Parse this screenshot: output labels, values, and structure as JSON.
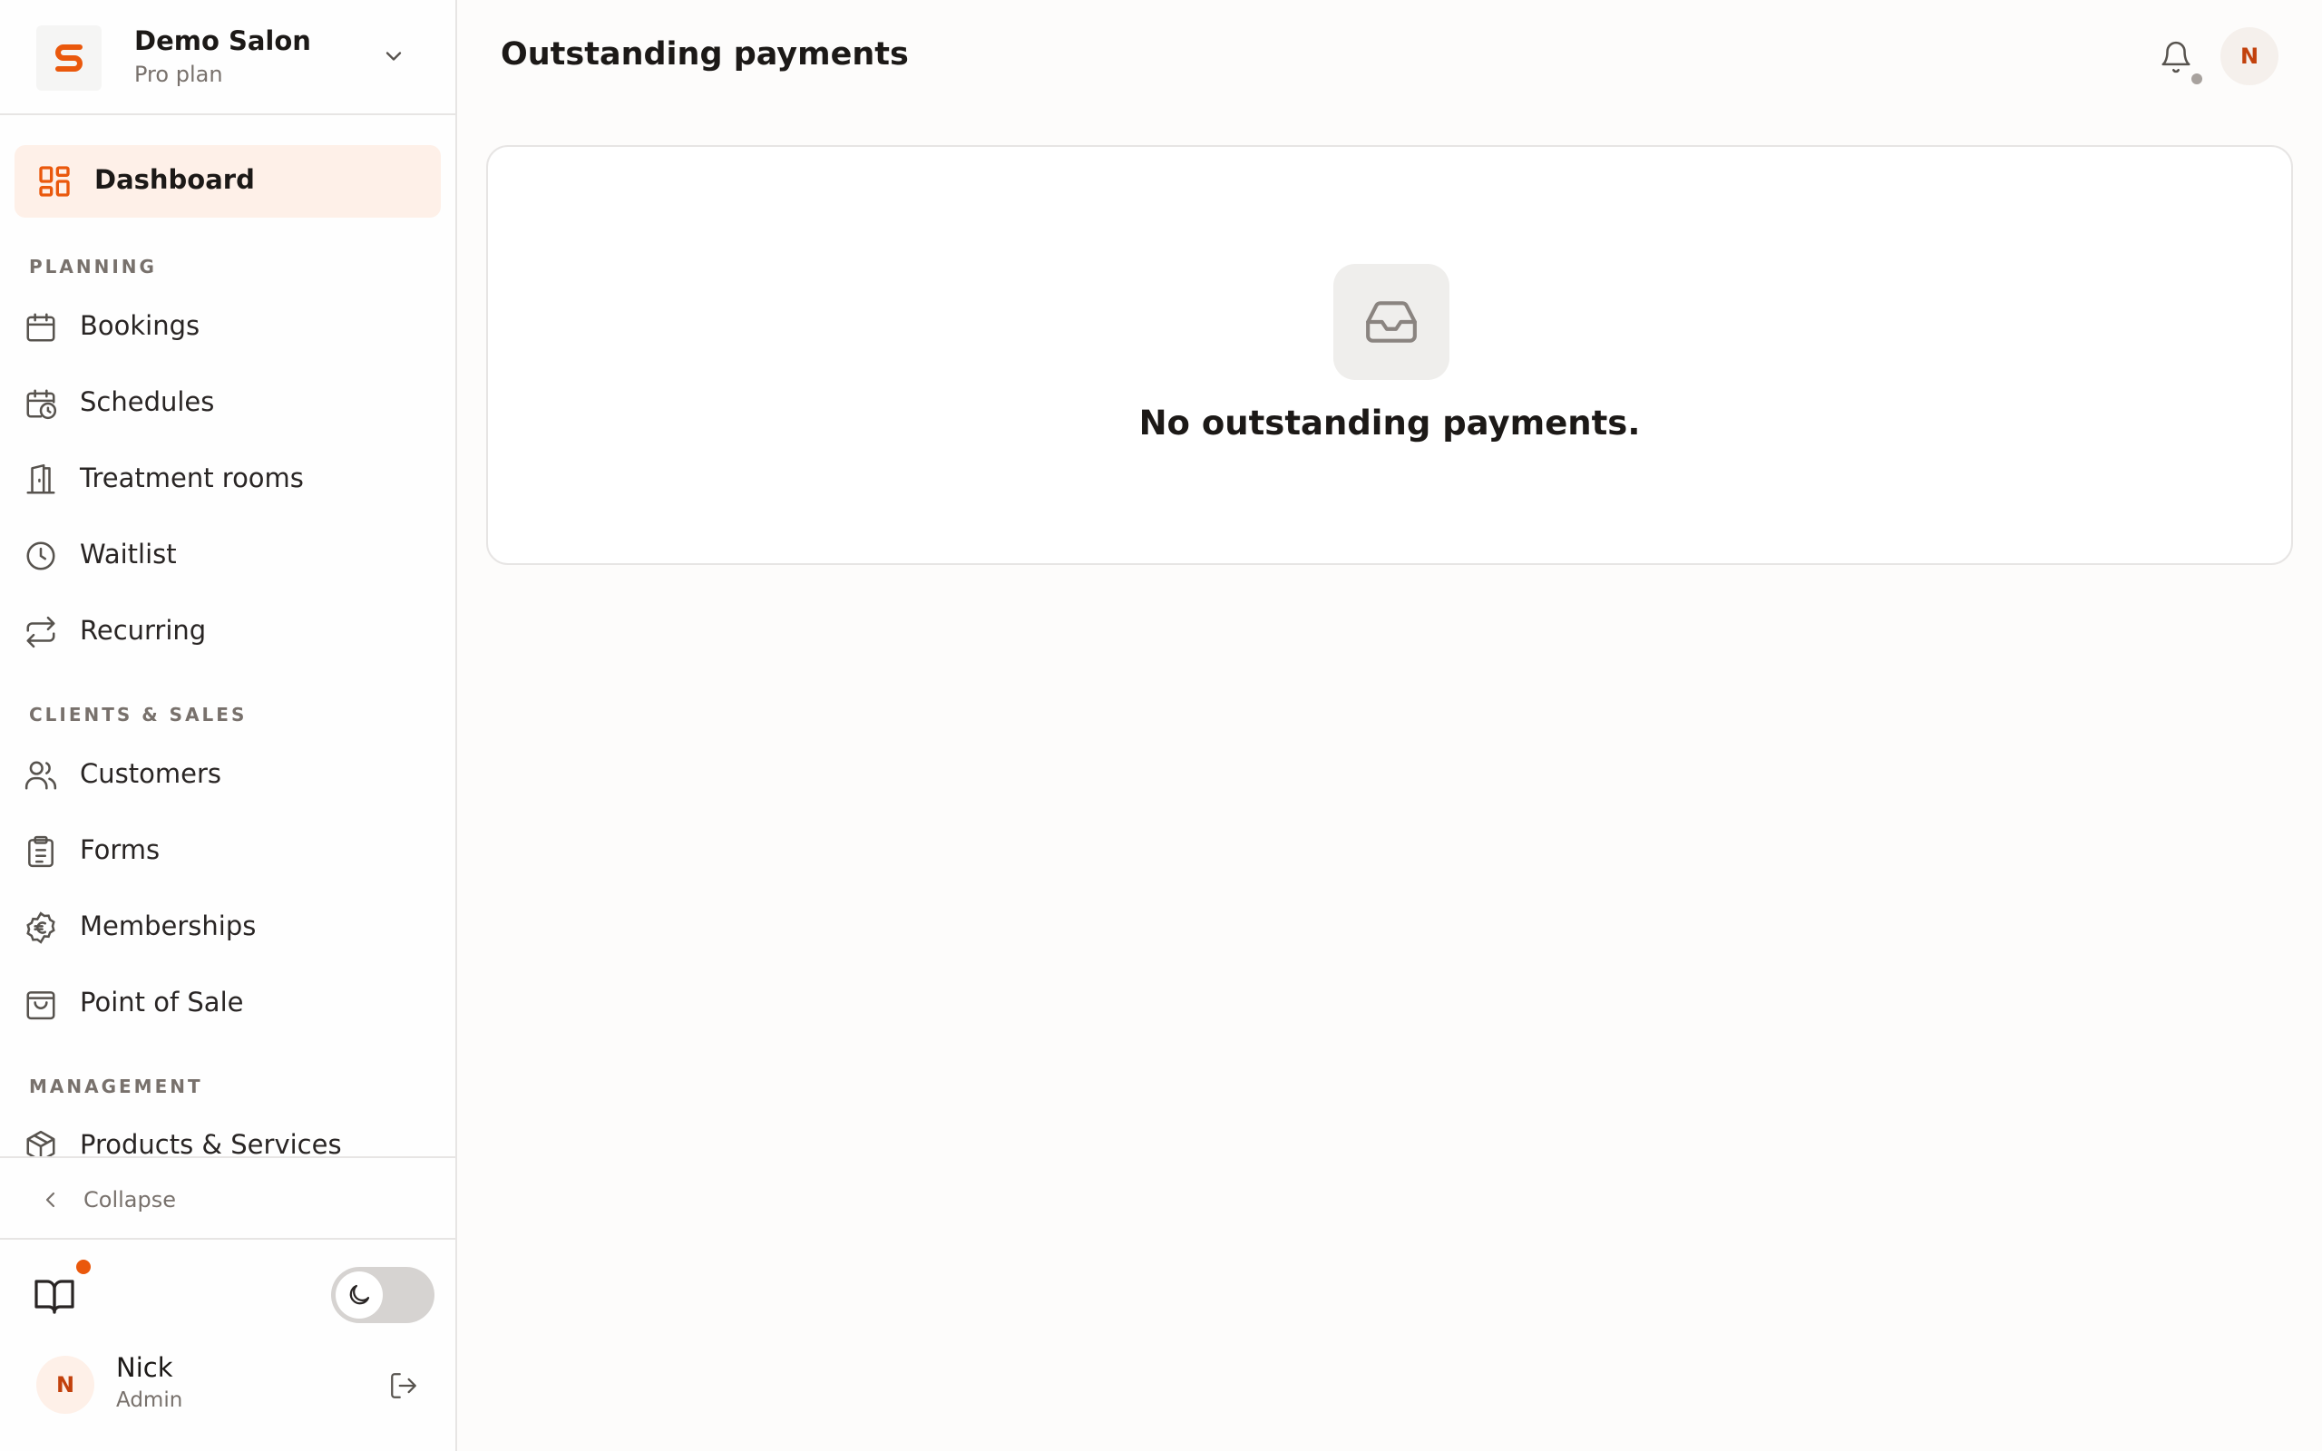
{
  "brand": {
    "name": "Demo Salon",
    "plan": "Pro plan",
    "accent": "#ea580c"
  },
  "sidebar": {
    "active_item": {
      "label": "Dashboard",
      "icon": "dashboard-grid-icon"
    },
    "sections": [
      {
        "title": "PLANNING",
        "items": [
          {
            "label": "Bookings",
            "icon": "calendar-icon"
          },
          {
            "label": "Schedules",
            "icon": "calendar-clock-icon"
          },
          {
            "label": "Treatment rooms",
            "icon": "door-icon"
          },
          {
            "label": "Waitlist",
            "icon": "clock-icon"
          },
          {
            "label": "Recurring",
            "icon": "repeat-icon"
          }
        ]
      },
      {
        "title": "CLIENTS & SALES",
        "items": [
          {
            "label": "Customers",
            "icon": "users-icon"
          },
          {
            "label": "Forms",
            "icon": "clipboard-list-icon"
          },
          {
            "label": "Memberships",
            "icon": "euro-badge-icon"
          },
          {
            "label": "Point of Sale",
            "icon": "shopping-bag-icon"
          }
        ]
      },
      {
        "title": "MANAGEMENT",
        "items": [
          {
            "label": "Products & Services",
            "icon": "package-icon"
          }
        ]
      }
    ],
    "collapse_label": "Collapse"
  },
  "user": {
    "initial": "N",
    "name": "Nick",
    "role": "Admin"
  },
  "header": {
    "title": "Outstanding payments",
    "avatar_initial": "N"
  },
  "empty_state": {
    "icon": "inbox-icon",
    "message": "No outstanding payments."
  }
}
